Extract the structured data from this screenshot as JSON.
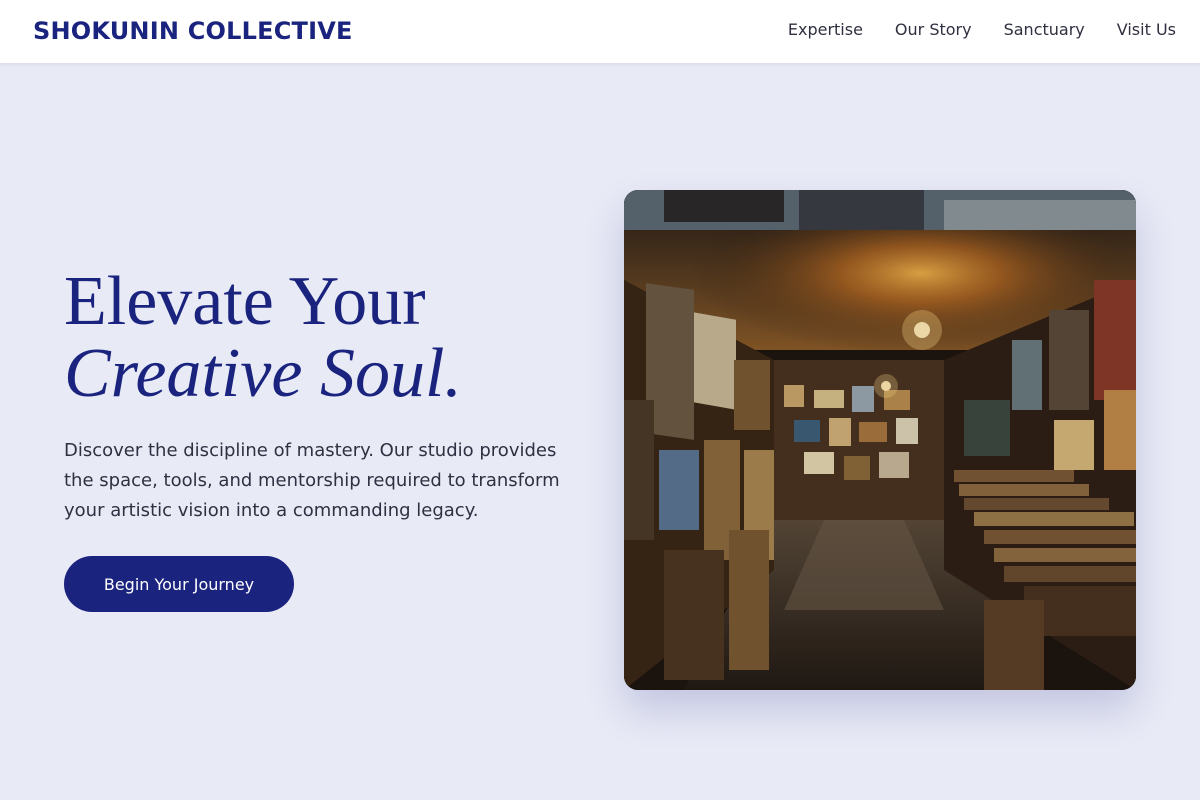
{
  "brand": {
    "name": "SHOKUNIN COLLECTIVE"
  },
  "nav": {
    "links": [
      {
        "label": "Expertise"
      },
      {
        "label": "Our Story"
      },
      {
        "label": "Sanctuary"
      },
      {
        "label": "Visit Us"
      }
    ]
  },
  "hero": {
    "title_line1": "Elevate Your",
    "title_line2": "Creative Soul.",
    "description": "Discover the discipline of mastery. Our studio provides the space, tools, and mentorship required to transform your artistic vision into a commanding legacy.",
    "cta_label": "Begin Your Journey",
    "image": {
      "subject": "art gallery corridor with stacked framed paintings"
    }
  },
  "colors": {
    "brand": "#1a237e",
    "page_bg": "#e8eaf6",
    "header_bg": "#ffffff",
    "button_text": "#ffffff"
  }
}
